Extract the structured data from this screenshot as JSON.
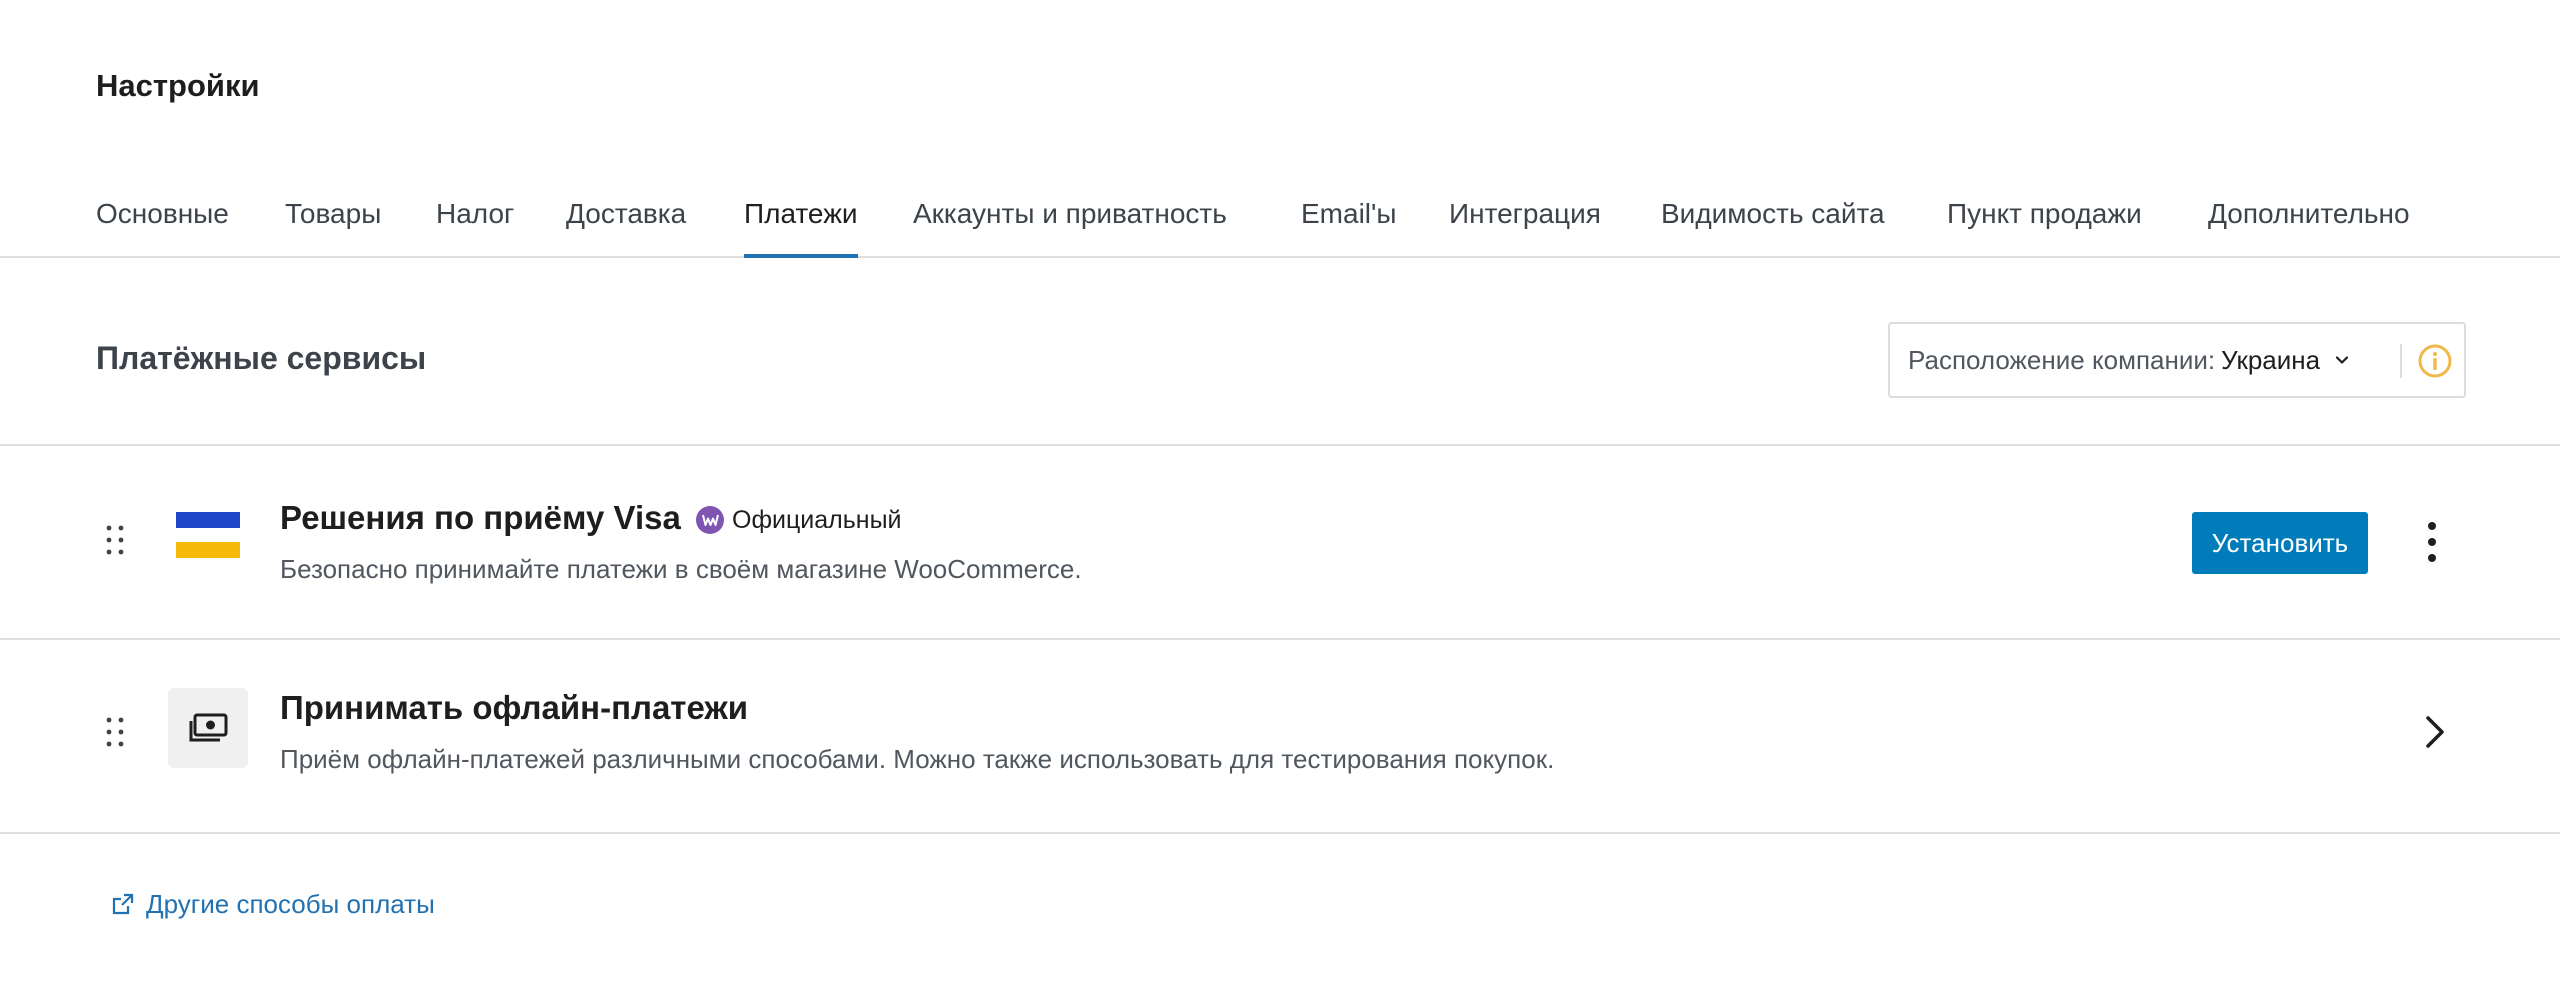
{
  "page": {
    "title": "Настройки"
  },
  "tabs": [
    {
      "label": "Основные"
    },
    {
      "label": "Товары"
    },
    {
      "label": "Налог"
    },
    {
      "label": "Доставка"
    },
    {
      "label": "Платежи",
      "active": true
    },
    {
      "label": "Аккаунты и приватность"
    },
    {
      "label": "Email'ы"
    },
    {
      "label": "Интеграция"
    },
    {
      "label": "Видимость сайта"
    },
    {
      "label": "Пункт продажи"
    },
    {
      "label": "Дополнительно"
    }
  ],
  "section": {
    "title": "Платёжные сервисы",
    "location_label": "Расположение компании:",
    "location_value": "Украина",
    "info_icon": "info-icon"
  },
  "providers": [
    {
      "title": "Решения по приёму Visa",
      "badge": "Официальный",
      "description": "Безопасно принимайте платежи в своём магазине WooCommerce.",
      "action_label": "Установить",
      "icon": "ukraine-flag-icon"
    },
    {
      "title": "Принимать офлайн-платежи",
      "description": "Приём офлайн-платежей различными способами. Можно также использовать для тестирования покупок.",
      "icon": "cash-icon"
    }
  ],
  "other_link": {
    "label": "Другие способы оплаты",
    "icon": "external-link-icon"
  },
  "colors": {
    "accent": "#2271b1",
    "button": "#007cba",
    "badge": "#7f54b3",
    "info": "#f0b849",
    "flag_blue": "#1e44c8",
    "flag_yellow": "#f5b90a"
  }
}
